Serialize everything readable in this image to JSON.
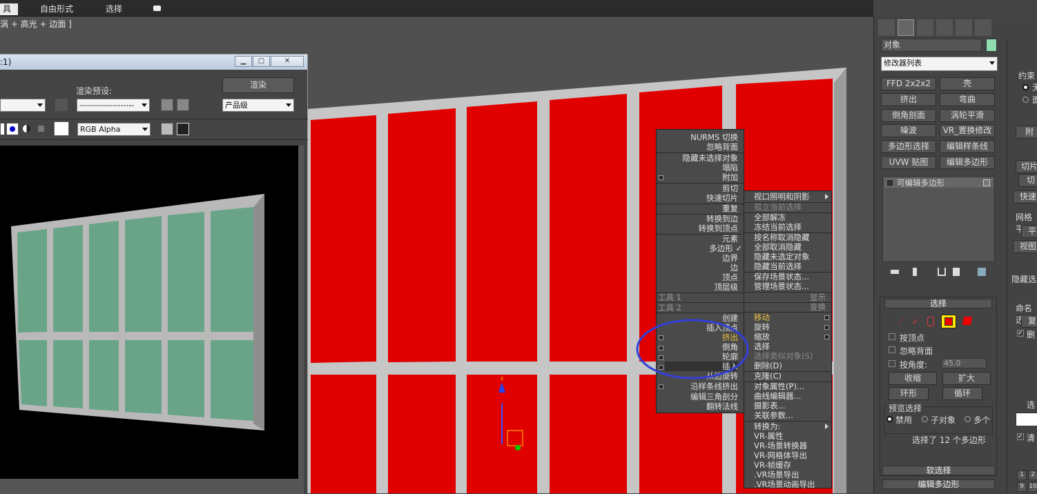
{
  "tabs": [
    {
      "label": "具"
    },
    {
      "label": "自由形式"
    },
    {
      "label": "选择"
    }
  ],
  "viewport_label": "涡 + 高光 + 边面 ]",
  "render_window": {
    "title": ":1)",
    "render_preset_label": "渲染预设:",
    "render_button": "渲染",
    "preset_value": "--------------------",
    "level_value": "产品级",
    "channel_value": "RGB Alpha"
  },
  "right_panel": {
    "object_name": "对象",
    "modifier_list": "修改器列表",
    "buttons": [
      {
        "label": "FFD 2x2x2"
      },
      {
        "label": "壳"
      },
      {
        "label": "挤出"
      },
      {
        "label": "弯曲"
      },
      {
        "label": "倒角剖面"
      },
      {
        "label": "涡轮平滑"
      },
      {
        "label": "噪波"
      },
      {
        "label": "VR_置换修改"
      },
      {
        "label": "多边形选择"
      },
      {
        "label": "编辑样条线"
      },
      {
        "label": "UVW 贴图"
      },
      {
        "label": "编辑多边形"
      }
    ],
    "stack_item": "可编辑多边形",
    "selection_header": "选择",
    "by_vertex": "按顶点",
    "ignore_backface": "忽略背面",
    "by_angle": "按角度:",
    "angle_value": "45.0",
    "shrink": "收缩",
    "grow": "扩大",
    "ring": "环形",
    "loop": "循环",
    "preview_label": "预览选择",
    "preview_opts": {
      "disable": "禁用",
      "subobj": "子对象",
      "multi": "多个"
    },
    "selected_status": "选择了 12 个多边形",
    "soft_sel": "软选择",
    "edit_poly": "编辑多边形"
  },
  "far_right": {
    "labels": [
      "约束",
      "无",
      "面",
      "附",
      "切片",
      "切",
      "快速",
      "网格平",
      "平",
      "视图",
      "隐藏选",
      "命名选",
      "复",
      "删",
      "选",
      "清"
    ],
    "tiles": [
      "1",
      "2",
      "9",
      "10"
    ]
  },
  "quad_left": {
    "items": [
      "NURMS 切换",
      "忽略背面",
      "隐藏未选择对象",
      "塌陷",
      "附加",
      "剪切",
      "快速切片",
      "重复",
      "转换到边",
      "转换到顶点",
      "元素",
      "多边形",
      "边界",
      "边",
      "顶点",
      "顶层级"
    ],
    "header1": "工具 1",
    "header2": "工具 2",
    "tools2": [
      "创建",
      "插入顶点",
      "挤出",
      "倒角",
      "轮廓",
      "插入",
      "从边旋转",
      "沿样条线挤出",
      "编辑三角剖分",
      "翻转法线"
    ]
  },
  "quad_right": {
    "items": [
      "视口照明和阴影",
      "孤立当前选择",
      "全部解冻",
      "冻结当前选择",
      "按名称取消隐藏",
      "全部取消隐藏",
      "隐藏未选定对象",
      "隐藏当前选择",
      "保存场景状态...",
      "管理场景状态..."
    ],
    "header1": "显示",
    "header2": "变换",
    "transform": [
      "移动",
      "旋转",
      "缩放",
      "选择",
      "选择类似对象(S)",
      "删除(D)",
      "克隆(C)",
      "对象属性(P)...",
      "曲线编辑器...",
      "摄影表...",
      "关联参数...",
      "转换为:",
      "VR-属性",
      "VR-场景转换器",
      "VR-网格体导出",
      "VR-帧缓存",
      ".VR场景导出",
      ".VR场景动画导出"
    ]
  },
  "colors": {
    "red": "#e00000",
    "frame": "#c8c8c8",
    "glass": "#6aa488",
    "highlight_circle": "#3340d8"
  }
}
